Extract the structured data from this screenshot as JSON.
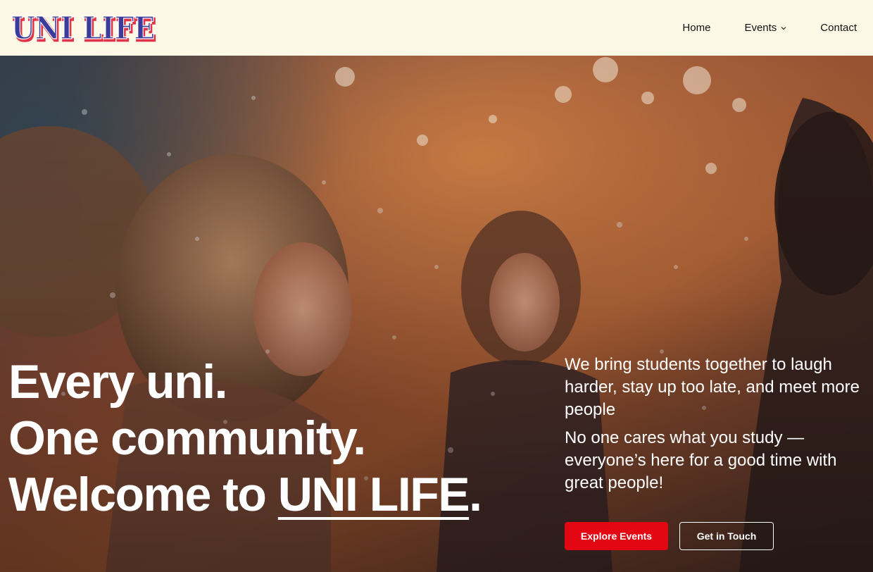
{
  "header": {
    "logo_text": "UNI LIFE",
    "nav": [
      {
        "label": "Home"
      },
      {
        "label": "Events",
        "has_dropdown": true
      },
      {
        "label": "Contact"
      }
    ]
  },
  "hero": {
    "headline": {
      "line1": "Every uni.",
      "line2": "One community.",
      "line3_prefix": "Welcome to ",
      "line3_brand": "UNI LIFE",
      "line3_suffix": "."
    },
    "paragraphs": [
      "We bring students together to laugh harder, stay up too late, and meet more people",
      "No one cares what you study — everyone’s here for a good time with great people!"
    ],
    "buttons": {
      "primary": "Explore Events",
      "secondary": "Get in Touch"
    }
  },
  "colors": {
    "header_bg": "#fdf9e6",
    "logo_blue": "#3b3b9b",
    "logo_red": "#e0344a",
    "primary_button": "#e30613",
    "text_on_hero": "#ffffff"
  },
  "icons": {
    "events_dropdown": "chevron-down-icon"
  }
}
